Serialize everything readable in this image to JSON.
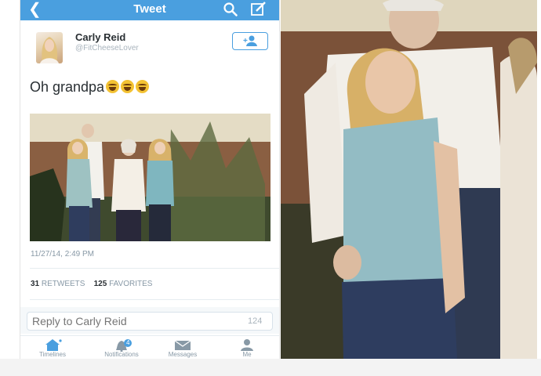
{
  "navbar": {
    "title": "Tweet",
    "back_icon": "chevron-left-icon",
    "search_icon": "search-icon",
    "compose_icon": "compose-icon",
    "background": "#4a9fdf"
  },
  "tweet": {
    "user_name": "Carly Reid",
    "user_handle": "@FitCheeseLover",
    "follow_icon": "add-user-icon",
    "text": "Oh grandpa",
    "emoji": [
      "face-with-tears-of-joy",
      "face-with-tears-of-joy",
      "face-with-tears-of-joy"
    ],
    "timestamp": "11/27/14, 2:49 PM",
    "retweets": "31",
    "retweets_label": "RETWEETS",
    "favorites": "125",
    "favorites_label": "FAVORITES"
  },
  "reply": {
    "placeholder": "Reply to Carly Reid",
    "char_count": "124"
  },
  "tabbar": {
    "items": [
      {
        "label": "Timelines",
        "icon": "home-icon"
      },
      {
        "label": "Notifications",
        "icon": "bell-icon",
        "badge": "4"
      },
      {
        "label": "Messages",
        "icon": "envelope-icon"
      },
      {
        "label": "Me",
        "icon": "person-icon"
      }
    ]
  },
  "colors": {
    "accent": "#4a9fdf",
    "text": "#292f33",
    "muted": "#8899a6"
  }
}
